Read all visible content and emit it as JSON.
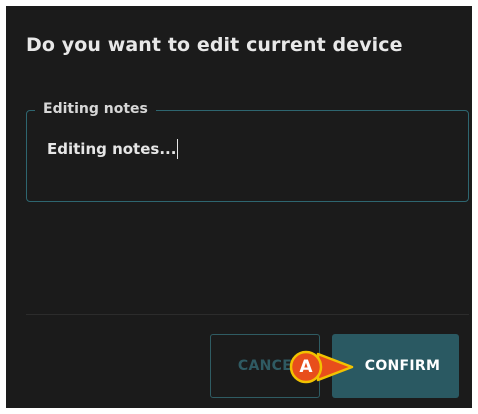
{
  "dialog": {
    "title": "Do you want to edit current device",
    "notes_field": {
      "label": "Editing notes",
      "value": "Editing notes..."
    },
    "buttons": {
      "cancel_label": "CANCE",
      "confirm_label": "CONFIRM"
    }
  },
  "annotation": {
    "marker_letter": "A"
  },
  "colors": {
    "dialog_background": "#1b1b1b",
    "accent": "#2a5962",
    "field_border": "#2e6670",
    "marker_fill": "#e84e1b",
    "marker_outline": "#f2c200"
  }
}
